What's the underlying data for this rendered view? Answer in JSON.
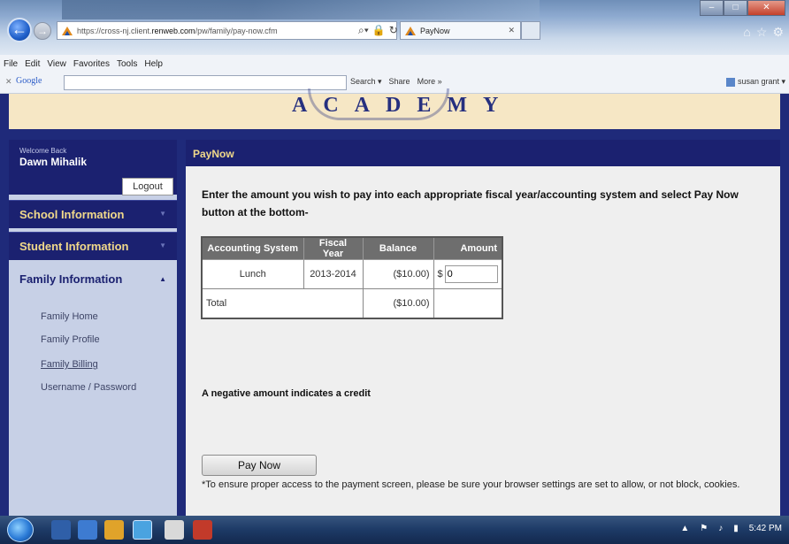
{
  "browser": {
    "url_prefix": "https://cross-nj.client.",
    "url_domain": "renweb.com",
    "url_path": "/pw/family/pay-now.cfm",
    "tab_title": "PayNow",
    "menu": [
      "File",
      "Edit",
      "View",
      "Favorites",
      "Tools",
      "Help"
    ],
    "google_label": "Google",
    "google_tools": [
      "Search ▾",
      "Share",
      "More »"
    ],
    "user": "susan grant ▾"
  },
  "header": {
    "logo_text": "ACADEMY"
  },
  "sidebar": {
    "welcome_label": "Welcome Back",
    "user_name": "Dawn Mihalik",
    "logout_label": "Logout",
    "sections": [
      {
        "label": "School Information"
      },
      {
        "label": "Student Information"
      },
      {
        "label": "Family Information"
      }
    ],
    "subitems": [
      "Family Home",
      "Family Profile",
      "Family Billing",
      "Username / Password"
    ]
  },
  "main": {
    "title": "PayNow",
    "instructions": "Enter the amount you wish to pay into each appropriate fiscal year/accounting system and select Pay Now button at the bottom-",
    "table": {
      "headers": [
        "Accounting System",
        "Fiscal Year",
        "Balance",
        "Amount"
      ],
      "row": {
        "system": "Lunch",
        "year": "2013-2014",
        "balance": "($10.00)",
        "currency": "$",
        "amount": "0"
      },
      "total": {
        "label": "Total",
        "balance": "($10.00)"
      }
    },
    "negative_note": "A negative amount indicates a credit",
    "pay_button": "Pay Now",
    "cookie_note": "*To ensure proper access to the payment screen, please be sure your browser settings are set to allow, or not block, cookies."
  },
  "taskbar": {
    "time": "5:42 PM"
  }
}
